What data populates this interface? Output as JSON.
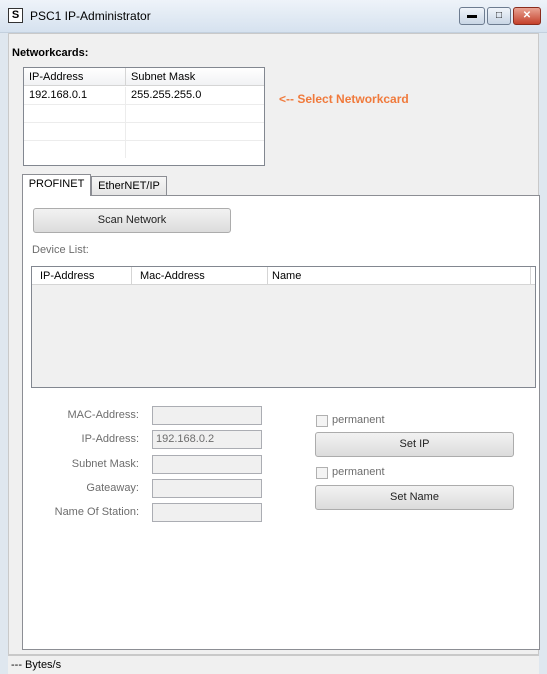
{
  "window": {
    "title": "PSC1 IP-Administrator",
    "icon_glyph": "S",
    "minimize_glyph": "▬",
    "maximize_glyph": "□",
    "close_glyph": "✕"
  },
  "networkcards": {
    "label": "Networkcards:",
    "columns": [
      "IP-Address",
      "Subnet Mask"
    ],
    "rows": [
      [
        "192.168.0.1",
        "255.255.255.0"
      ]
    ],
    "hint": "<-- Select Networkcard"
  },
  "tabs": [
    {
      "label": "PROFINET",
      "active": true
    },
    {
      "label": "EtherNET/IP",
      "active": false
    }
  ],
  "profinet": {
    "scan_button": "Scan Network",
    "device_list_label": "Device List:",
    "device_columns": [
      "IP-Address",
      "Mac-Address",
      "Name"
    ],
    "fields": {
      "mac_label": "MAC-Address:",
      "mac_value": "",
      "ip_label": "IP-Address:",
      "ip_value": "192.168.0.2",
      "subnet_label": "Subnet Mask:",
      "subnet_value": "",
      "gateway_label": "Gateaway:",
      "gateway_value": "",
      "station_label": "Name Of Station:",
      "station_value": ""
    },
    "permanent_ip_label": "permanent",
    "set_ip_button": "Set IP",
    "permanent_name_label": "permanent",
    "set_name_button": "Set Name"
  },
  "status": {
    "text": "--- Bytes/s"
  }
}
